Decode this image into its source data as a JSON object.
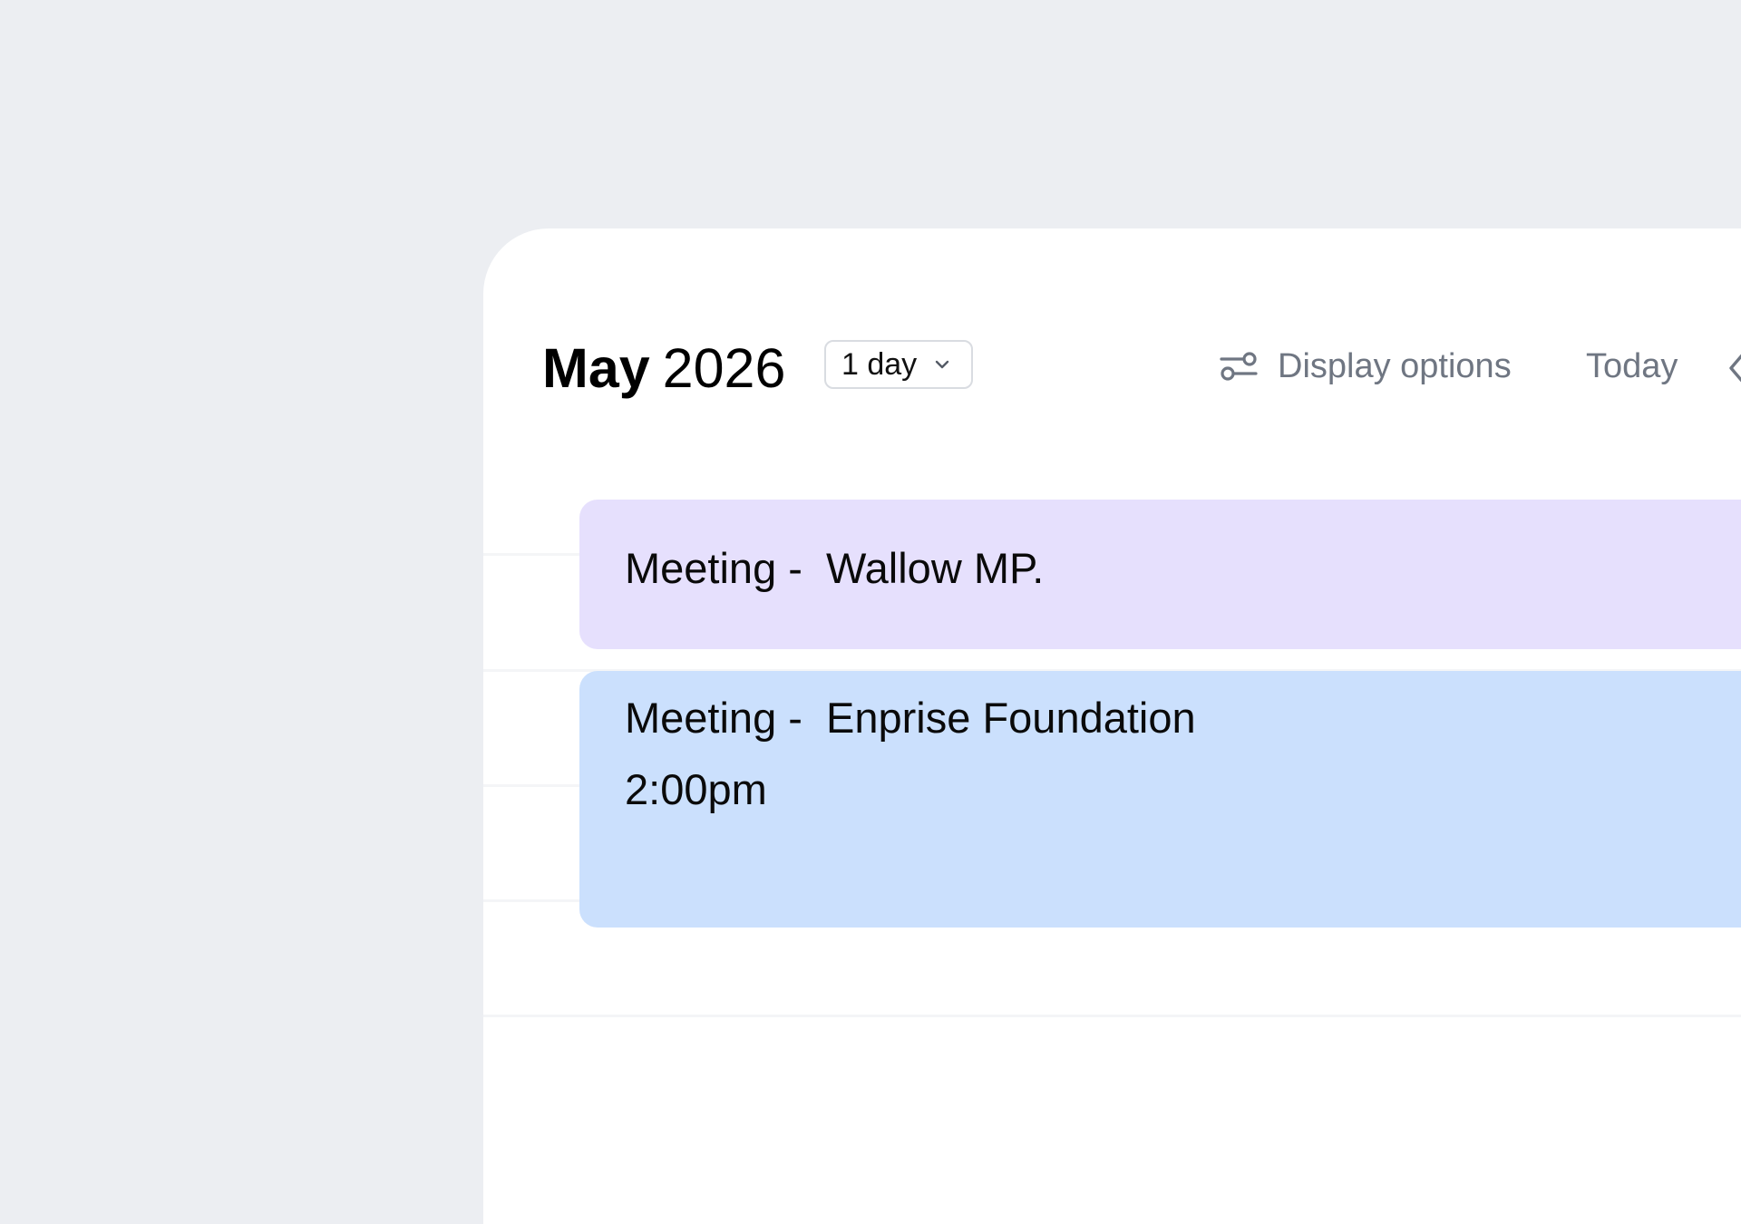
{
  "header": {
    "month": "May",
    "year": "2026"
  },
  "view_select": {
    "label": "1 day",
    "chevron_icon": "chevron-down-icon"
  },
  "toolbar": {
    "display_options_label": "Display options",
    "display_options_icon": "sliders-icon",
    "today_label": "Today",
    "prev_icon": "chevron-left-icon"
  },
  "events": [
    {
      "title": "Meeting -  Wallow MP.",
      "time": "",
      "color": "#e6e0fd"
    },
    {
      "title": "Meeting -  Enprise Foundation",
      "time": "2:00pm",
      "color": "#cbe0fd"
    }
  ],
  "colors": {
    "background": "#eceef2",
    "panel": "#ffffff",
    "muted_text": "#6f7682"
  }
}
